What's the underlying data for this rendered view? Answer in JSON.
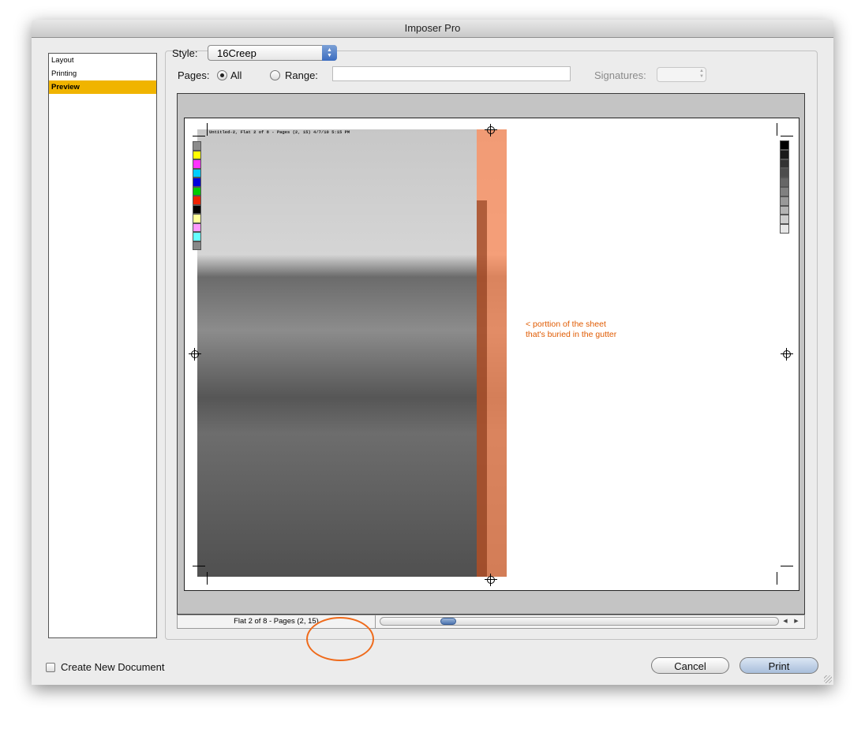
{
  "window": {
    "title": "Imposer Pro"
  },
  "sidebar": {
    "items": [
      {
        "label": "Layout",
        "selected": false
      },
      {
        "label": "Printing",
        "selected": false
      },
      {
        "label": "Preview",
        "selected": true
      }
    ]
  },
  "style": {
    "label": "Style:",
    "value": "16Creep"
  },
  "pages": {
    "label": "Pages:",
    "all_label": "All",
    "range_label": "Range:",
    "selected": "All",
    "range_value": ""
  },
  "signatures": {
    "label": "Signatures:",
    "value": ""
  },
  "preview": {
    "slug_text": "Untitled-2, Flat 2 of 8 - Pages (2, 15) 4/7/10 5:15 PM",
    "annotation_line1": "< porttion of the sheet",
    "annotation_line2": "that's buried in the gutter",
    "color_bar": [
      "#8c8c8c",
      "#ffff00",
      "#ff33ff",
      "#00ccff",
      "#0000dd",
      "#00cc00",
      "#ee2200",
      "#000000",
      "#ffff99",
      "#ff99ff",
      "#66ffff",
      "#888888"
    ],
    "gray_bar": [
      "#000000",
      "#1a1a1a",
      "#333333",
      "#4d4d4d",
      "#666666",
      "#808080",
      "#999999",
      "#b3b3b3",
      "#cccccc",
      "#e6e6e6"
    ],
    "gutter_color": "#ff8c5a"
  },
  "status": {
    "text": "Flat 2 of 8 - Pages (2, 15)"
  },
  "footer": {
    "create_new_document_label": "Create New Document",
    "create_new_document_checked": false,
    "cancel_label": "Cancel",
    "print_label": "Print"
  }
}
